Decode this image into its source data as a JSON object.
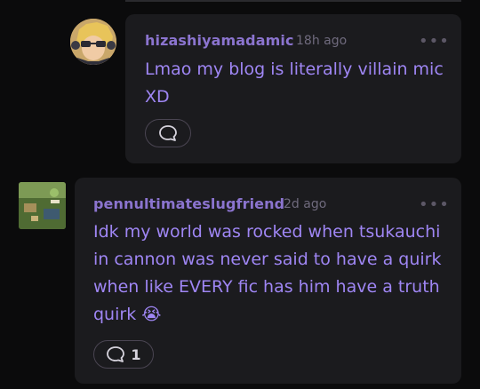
{
  "comments": [
    {
      "username": "hizashiyamadamic",
      "time": "18h ago",
      "more_label": "•••",
      "text": "Lmao my blog is literally villain mic XD",
      "reply_count": "",
      "avatar": "avatar-icon"
    },
    {
      "username": "pennultimateslugfriend",
      "time": "2d ago",
      "more_label": "•••",
      "text": "Idk my world was rocked when tsukauchi in cannon was never said to have a quirk when like EVERY fic has him have a truth quirk 😭",
      "reply_count": "1",
      "avatar": "avatar-icon"
    }
  ],
  "colors": {
    "background": "#0b0b0c",
    "bubble": "#1b1b1e",
    "username": "#8b74cf",
    "body_text": "#9f86f4",
    "timestamp": "#6f6a7d"
  }
}
